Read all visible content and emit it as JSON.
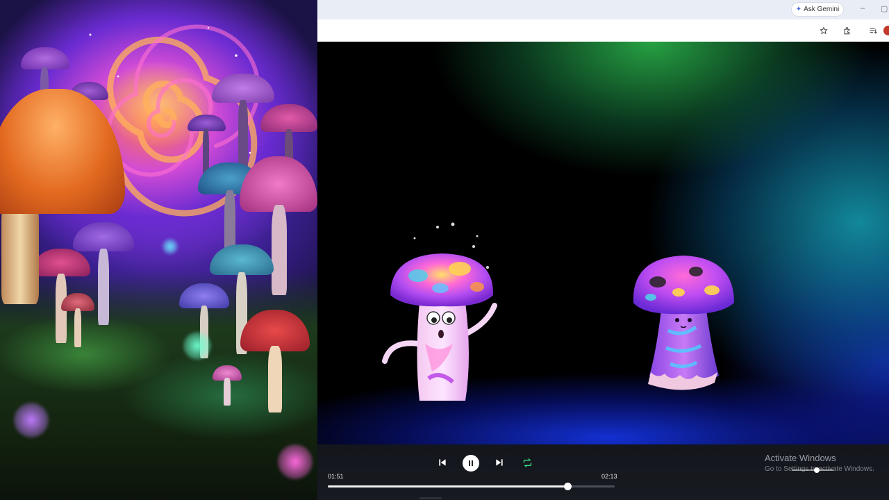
{
  "browser": {
    "ask_gemini_label": "Ask Gemini",
    "window_controls": [
      "–",
      "▢"
    ],
    "toolbar_icons": [
      "star-icon",
      "extensions-icon",
      "reading-list-icon"
    ]
  },
  "player": {
    "current_time": "01:51",
    "duration": "02:13",
    "progress_fraction": 0.835,
    "state": "playing",
    "accent_color": "#3ddc84"
  },
  "watermark": {
    "title": "Activate Windows",
    "subtitle": "Go to Settings to activate Windows."
  }
}
